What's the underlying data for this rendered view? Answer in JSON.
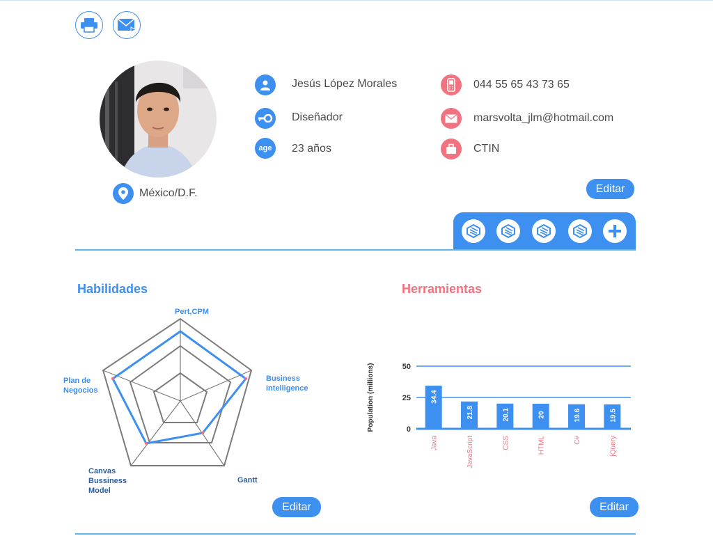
{
  "header": {
    "print_icon": "printer-icon",
    "mail_icon": "mail-forward-icon"
  },
  "profile": {
    "location": "México/D.F.",
    "name": "Jesús López Morales",
    "role": "Diseñador",
    "age_badge": "age",
    "age": "23 años",
    "phone": "044 55 65 43 73 65",
    "email": "marsvolta_jlm@hotmail.com",
    "company": "CTIN",
    "edit_label": "Editar"
  },
  "tools_tray": {
    "items": [
      "layers-icon",
      "layers-icon",
      "layers-icon",
      "layers-icon"
    ],
    "add": "plus-icon"
  },
  "habilidades": {
    "title": "Habilidades",
    "labels": {
      "top": "Pert,CPM",
      "right_1": "Business",
      "right_2": "Intelligence",
      "bottom_right": "Gantt",
      "bottom_left_1": "Canvas",
      "bottom_left_2": "Bussiness",
      "bottom_left_3": "Model",
      "left_1": "Plan de",
      "left_2": "Negocios"
    },
    "values": [
      0.8,
      0.9,
      0.45,
      0.6,
      0.95
    ],
    "edit_label": "Editar"
  },
  "herramientas": {
    "title": "Herramientas",
    "edit_label": "Editar"
  },
  "chart_data": {
    "type": "bar",
    "ylabel": "Population (millions)",
    "categories": [
      "Java",
      "JavaScript",
      "CSS",
      "HTML",
      "C#",
      "jQuery"
    ],
    "values": [
      34.4,
      21.8,
      20.1,
      20,
      19.6,
      19.5
    ],
    "value_labels": [
      "34.4",
      "21.8",
      "20.1",
      "20",
      "19.6",
      "19.5"
    ],
    "yticks": [
      "0",
      "25",
      "50"
    ],
    "ylim": [
      0,
      50
    ],
    "colors": {
      "bar": "#3d8ff0",
      "category": "#f2727f",
      "grid": "#3d8ff0"
    }
  },
  "colors": {
    "accent_blue": "#3d8ff0",
    "accent_pink": "#f2727f"
  }
}
